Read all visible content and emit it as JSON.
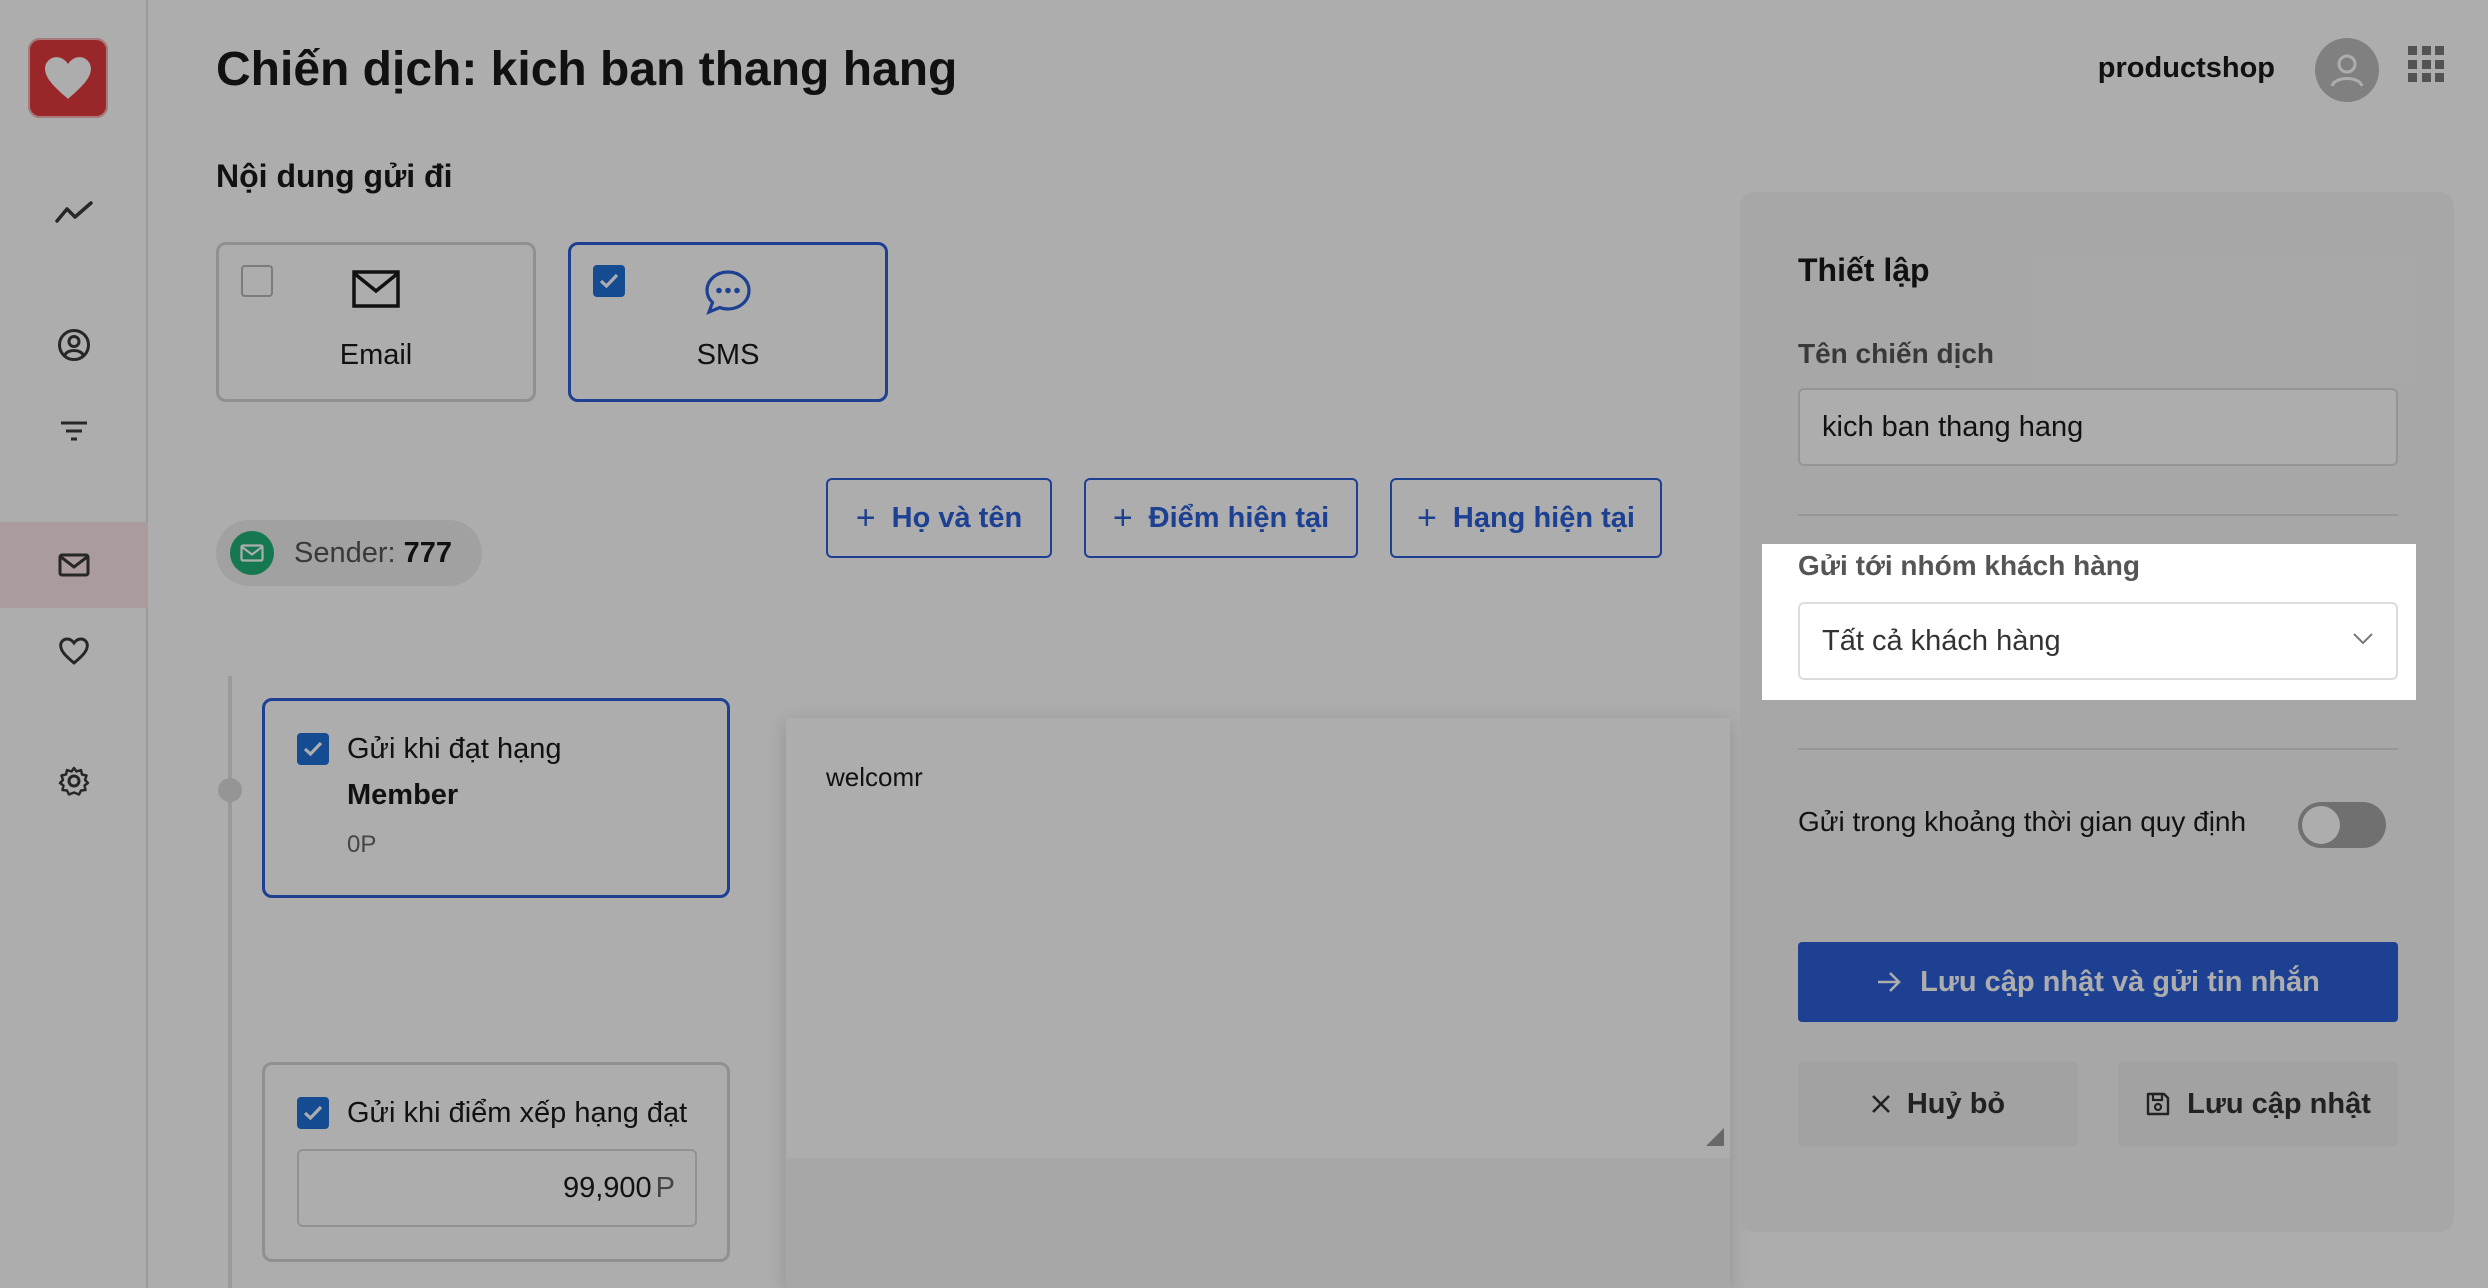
{
  "header": {
    "title": "Chiến dịch: kich ban thang hang",
    "shop_name": "productshop"
  },
  "sidebar": {
    "items": [
      {
        "icon": "trend-chart-icon"
      },
      {
        "icon": "user-circle-icon"
      },
      {
        "icon": "filter-icon"
      },
      {
        "icon": "mail-icon",
        "active": true
      },
      {
        "icon": "heart-icon"
      },
      {
        "icon": "gear-icon"
      }
    ]
  },
  "content": {
    "section_title": "Nội dung gửi đi",
    "channels": [
      {
        "label": "Email",
        "checked": false,
        "icon": "envelope-icon"
      },
      {
        "label": "SMS",
        "checked": true,
        "icon": "chat-bubble-icon"
      }
    ],
    "sender": {
      "prefix": "Sender:",
      "value": "777"
    },
    "tier_card_1": {
      "line1": "Gửi khi đạt hạng",
      "tier": "Member",
      "points": "0P"
    },
    "tier_card_2": {
      "line1": "Gửi khi điểm xếp hạng đạt",
      "value": "99,900",
      "unit": "P"
    },
    "message": "welcomr",
    "insert_buttons": [
      "Họ và tên",
      "Điểm hiện tại",
      "Hạng hiện tại"
    ]
  },
  "settings": {
    "title": "Thiết lập",
    "campaign_name_label": "Tên chiến dịch",
    "campaign_name_value": "kich ban thang hang",
    "group_label": "Gửi tới nhóm khách hàng",
    "group_value": "Tất cả khách hàng",
    "schedule_label": "Gửi trong khoảng thời gian quy định",
    "schedule_enabled": false,
    "primary_button": "Lưu cập nhật và gửi tin nhắn",
    "cancel_button": "Huỷ bỏ",
    "save_button": "Lưu cập nhật"
  },
  "colors": {
    "accent": "#2c5fd8",
    "brand": "#e23a3e",
    "sender_dot": "#1fb178"
  }
}
